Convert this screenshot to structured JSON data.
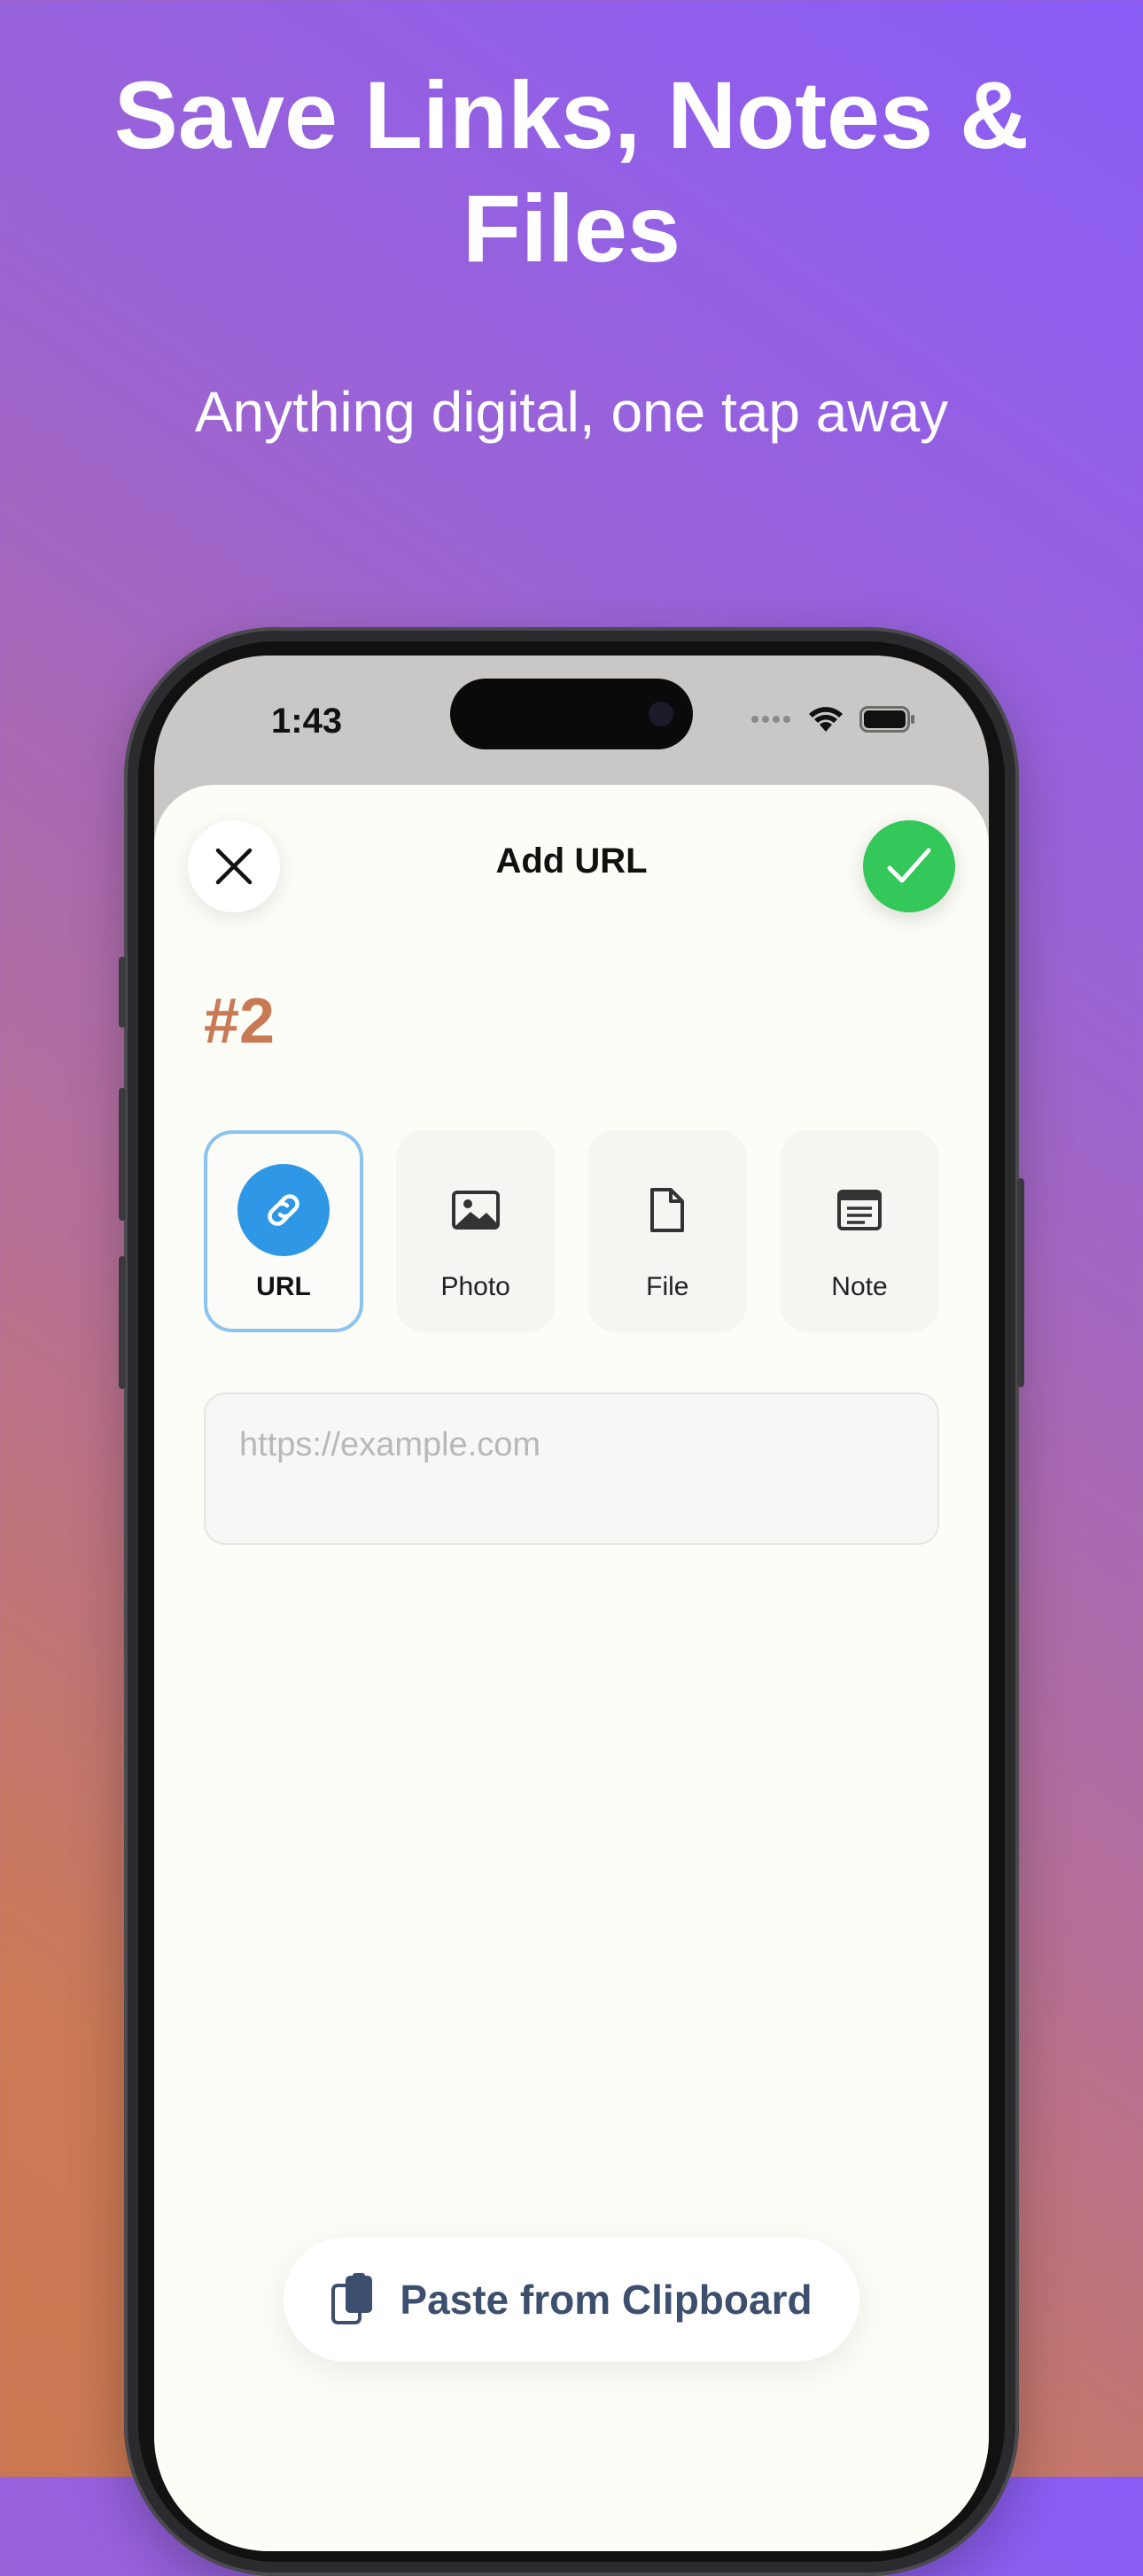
{
  "hero": {
    "title": "Save Links, Notes & Files",
    "subtitle": "Anything digital, one tap away"
  },
  "status_bar": {
    "time": "1:43",
    "icons": [
      "cellular-icon",
      "wifi-icon",
      "battery-icon"
    ]
  },
  "sheet": {
    "title": "Add URL",
    "close_icon": "close-icon",
    "confirm_icon": "checkmark-icon",
    "item_number": "#2"
  },
  "types": [
    {
      "label": "URL",
      "icon": "link-icon",
      "selected": true
    },
    {
      "label": "Photo",
      "icon": "photo-icon",
      "selected": false
    },
    {
      "label": "File",
      "icon": "file-icon",
      "selected": false
    },
    {
      "label": "Note",
      "icon": "note-icon",
      "selected": false
    }
  ],
  "url_input": {
    "value": "",
    "placeholder": "https://example.com"
  },
  "paste_button": {
    "label": "Paste from Clipboard",
    "icon": "clipboard-icon"
  },
  "colors": {
    "accent_blue": "#2f98e6",
    "confirm_green": "#34c759",
    "number_orange": "#c87a55",
    "paste_text": "#3d4f6e"
  }
}
